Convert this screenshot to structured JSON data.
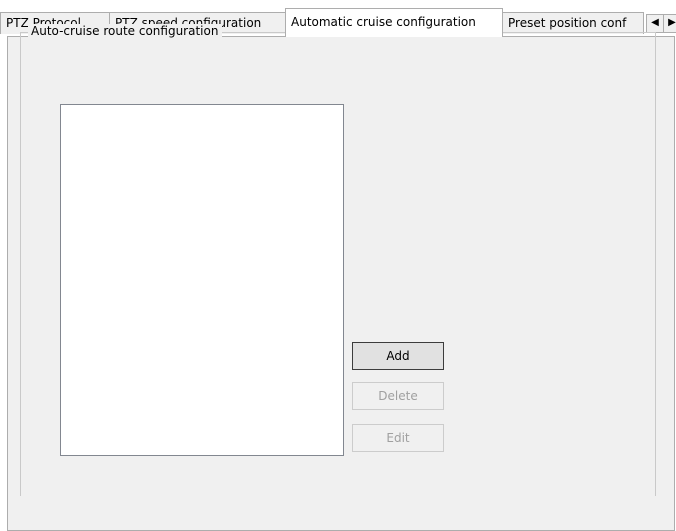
{
  "tabs": [
    {
      "label": "PTZ Protocol",
      "active": false
    },
    {
      "label": "PTZ speed configuration",
      "active": false
    },
    {
      "label": "Automatic cruise configuration",
      "active": true
    },
    {
      "label": "Preset position conf",
      "active": false
    }
  ],
  "tab_scroll": {
    "left_icon": "triangle-left-icon",
    "right_icon": "triangle-right-icon"
  },
  "group": {
    "title": "Auto-cruise route configuration"
  },
  "route_list": {
    "items": []
  },
  "buttons": {
    "add": "Add",
    "delete": "Delete",
    "edit": "Edit"
  }
}
